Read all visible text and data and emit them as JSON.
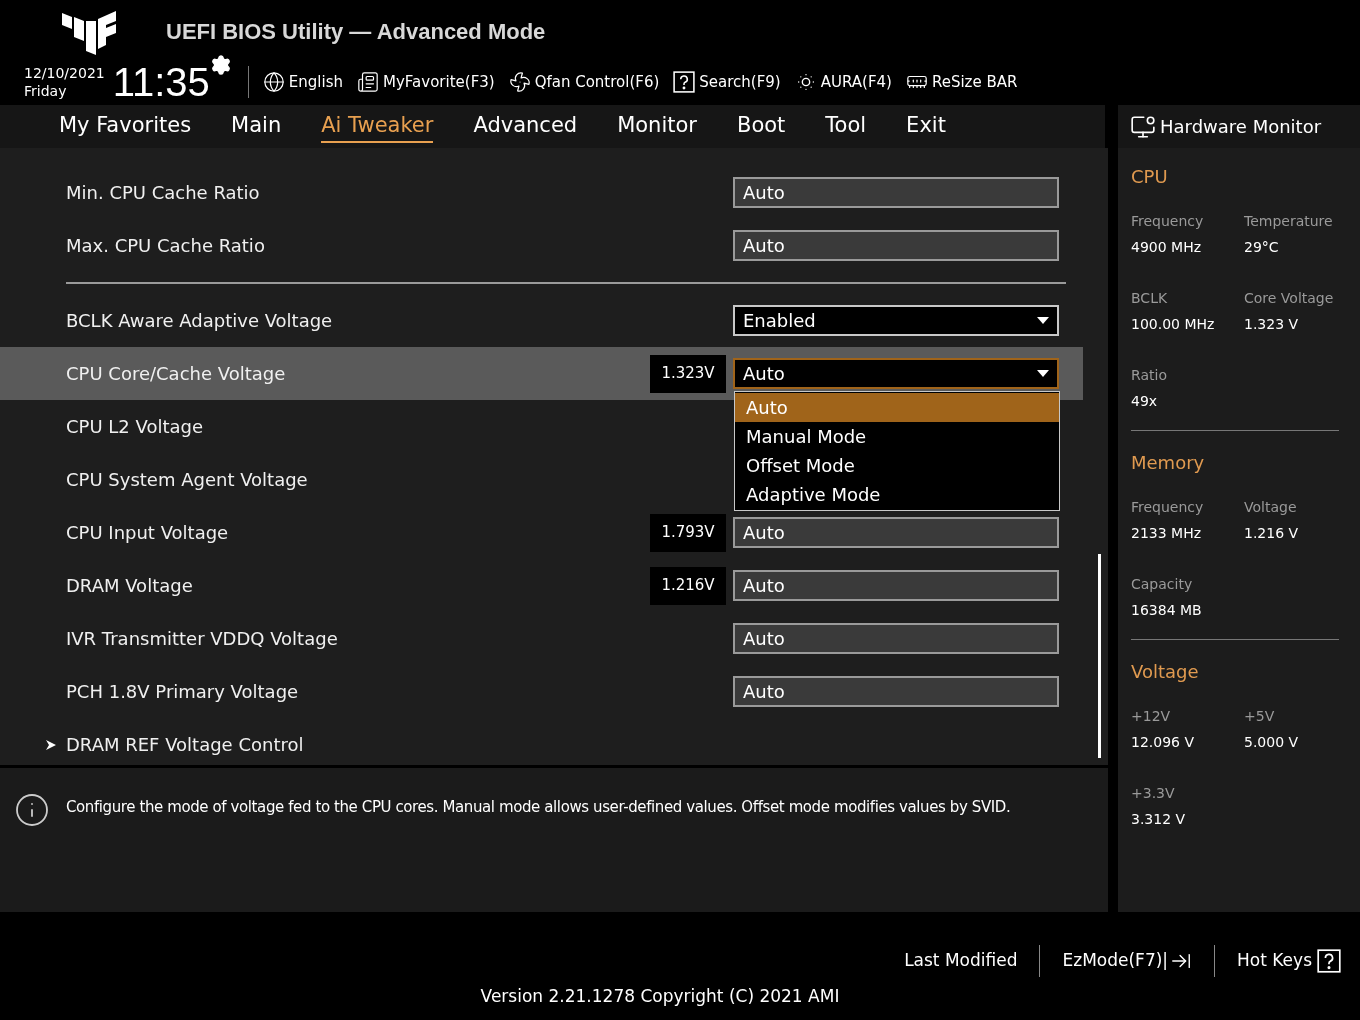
{
  "header": {
    "title": "UEFI BIOS Utility — Advanced Mode",
    "date": "12/10/2021",
    "day": "Friday",
    "time": "11:35",
    "toolbar": [
      {
        "kind": "globe",
        "label": "English"
      },
      {
        "kind": "favorite",
        "label": "MyFavorite(F3)"
      },
      {
        "kind": "fan",
        "label": "Qfan Control(F6)"
      },
      {
        "kind": "search",
        "label": "Search(F9)"
      },
      {
        "kind": "aura",
        "label": "AURA(F4)"
      },
      {
        "kind": "bar",
        "label": "ReSize BAR"
      }
    ]
  },
  "tabs": [
    {
      "label": "My Favorites",
      "selected": false
    },
    {
      "label": "Main",
      "selected": false
    },
    {
      "label": "Ai Tweaker",
      "selected": true
    },
    {
      "label": "Advanced",
      "selected": false
    },
    {
      "label": "Monitor",
      "selected": false
    },
    {
      "label": "Boot",
      "selected": false
    },
    {
      "label": "Tool",
      "selected": false
    },
    {
      "label": "Exit",
      "selected": false
    }
  ],
  "settings": [
    {
      "kind": "field",
      "label": "Min. CPU Cache Ratio",
      "value": "Auto",
      "selected": false
    },
    {
      "kind": "field",
      "label": "Max. CPU Cache Ratio",
      "value": "Auto",
      "selected": false
    },
    {
      "kind": "separator"
    },
    {
      "kind": "dropdown",
      "label": "BCLK Aware Adaptive Voltage",
      "value": "Enabled",
      "selected": false
    },
    {
      "kind": "dropdown",
      "label": "CPU Core/Cache Voltage",
      "value": "Auto",
      "reading": "1.323V",
      "selected": true,
      "expanded": true,
      "options": [
        {
          "label": "Auto",
          "selected": true
        },
        {
          "label": "Manual Mode",
          "selected": false
        },
        {
          "label": "Offset Mode",
          "selected": false
        },
        {
          "label": "Adaptive Mode",
          "selected": false
        }
      ]
    },
    {
      "kind": "label",
      "label": "CPU L2 Voltage",
      "selected": false
    },
    {
      "kind": "label",
      "label": "CPU System Agent Voltage",
      "selected": false
    },
    {
      "kind": "field",
      "label": "CPU Input Voltage",
      "value": "Auto",
      "reading": "1.793V",
      "selected": false
    },
    {
      "kind": "field",
      "label": "DRAM Voltage",
      "value": "Auto",
      "reading": "1.216V",
      "selected": false
    },
    {
      "kind": "field",
      "label": "IVR Transmitter VDDQ Voltage",
      "value": "Auto",
      "selected": false
    },
    {
      "kind": "field",
      "label": "PCH 1.8V Primary Voltage",
      "value": "Auto",
      "selected": false
    },
    {
      "kind": "submenu",
      "label": "DRAM REF Voltage Control",
      "selected": false
    }
  ],
  "help": "Configure the mode of voltage fed to the CPU cores. Manual mode allows user-defined values. Offset mode modifies values by SVID.",
  "monitor": {
    "title": "Hardware Monitor",
    "sections": [
      {
        "title": "CPU",
        "items": [
          {
            "label": "Frequency",
            "value": "4900 MHz"
          },
          {
            "label": "Temperature",
            "value": "29°C"
          },
          {
            "label": "BCLK",
            "value": "100.00 MHz"
          },
          {
            "label": "Core Voltage",
            "value": "1.323 V"
          },
          {
            "label": "Ratio",
            "value": "49x"
          }
        ]
      },
      {
        "title": "Memory",
        "items": [
          {
            "label": "Frequency",
            "value": "2133 MHz"
          },
          {
            "label": "Voltage",
            "value": "1.216 V"
          },
          {
            "label": "Capacity",
            "value": "16384 MB"
          }
        ]
      },
      {
        "title": "Voltage",
        "items": [
          {
            "label": "+12V",
            "value": "12.096 V"
          },
          {
            "label": "+5V",
            "value": "5.000 V"
          },
          {
            "label": "+3.3V",
            "value": "3.312 V"
          }
        ]
      }
    ]
  },
  "footer": {
    "buttons": [
      {
        "kind": "plain",
        "label": "Last Modified"
      },
      {
        "kind": "ezmode",
        "label": "EzMode(F7)|"
      },
      {
        "kind": "hotkeys",
        "label": "Hot Keys"
      }
    ],
    "version": "Version 2.21.1278 Copyright (C) 2021 AMI"
  }
}
